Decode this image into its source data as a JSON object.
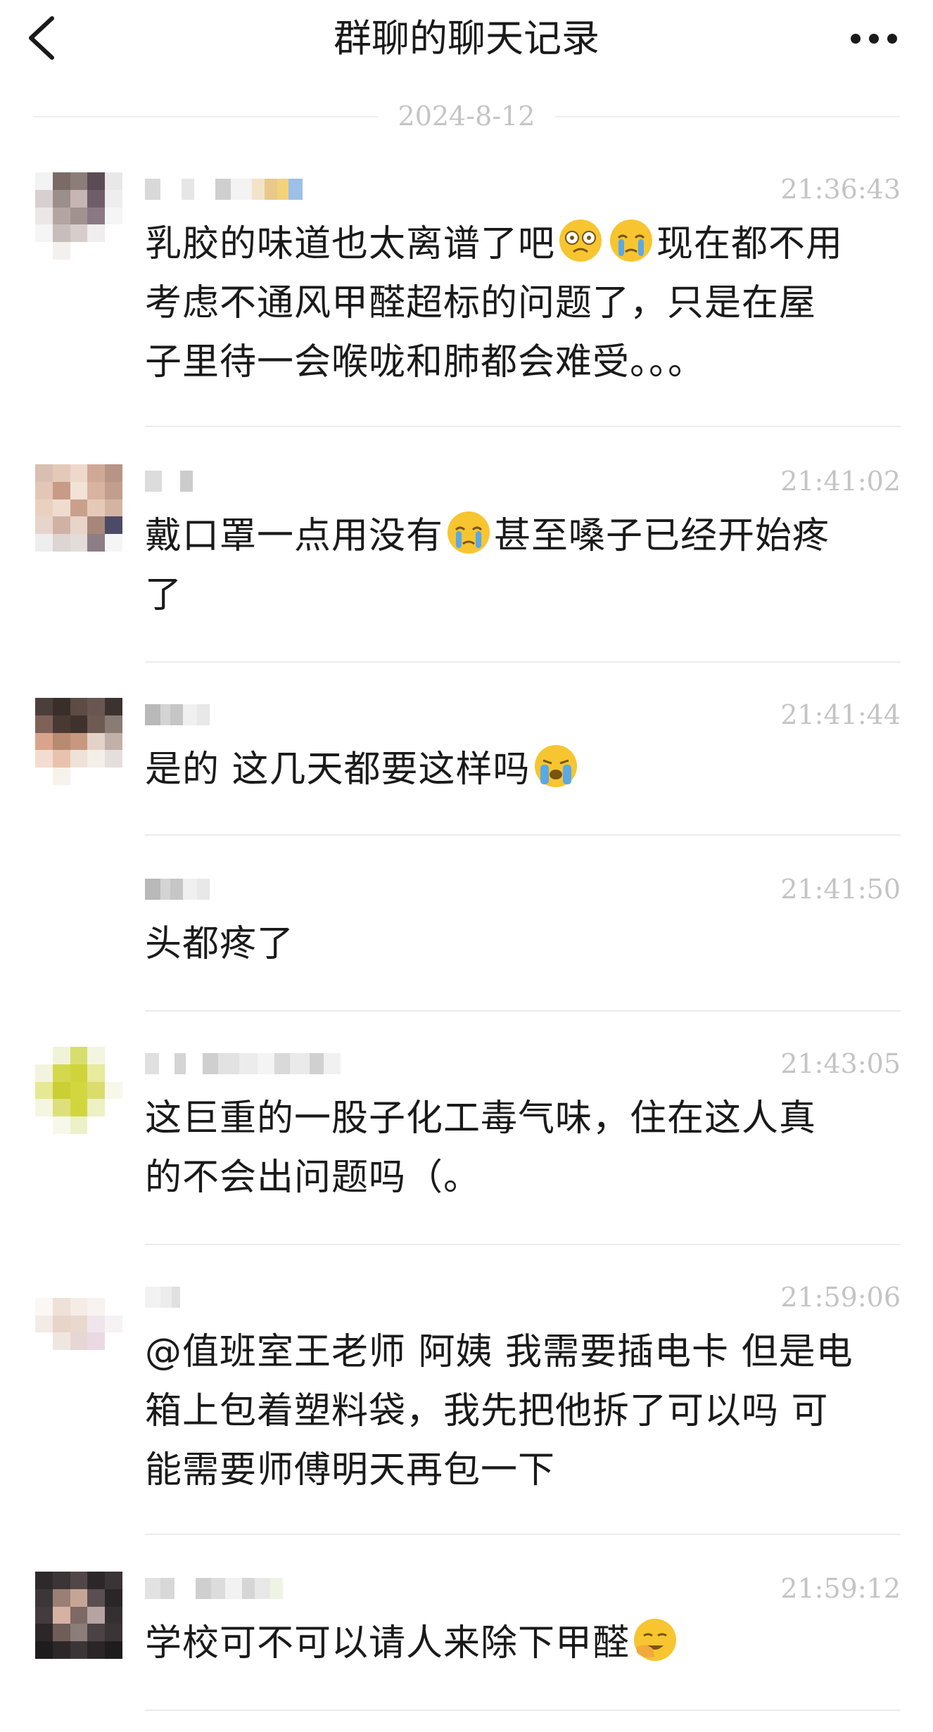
{
  "header": {
    "title": "群聊的聊天记录"
  },
  "date": "2024-8-12",
  "messages": [
    {
      "time": "21:36:43",
      "line1": "乳胶的味道也太离谱了吧",
      "line1b": "现在都不用",
      "line2": "考虑不通风甲醛超标的问题了，只是在屋",
      "line3": "子里待一会喉咙和肺都会难受。。。",
      "emojis": [
        "dizzy-face-icon",
        "crying-face-icon"
      ]
    },
    {
      "time": "21:41:02",
      "line1": "戴口罩一点用没有",
      "line1b": "甚至嗓子已经开始疼",
      "line2": "了",
      "emojis": [
        "crying-face-icon"
      ]
    },
    {
      "time": "21:41:44",
      "line1": "是的 这几天都要这样吗",
      "emojis": [
        "loudly-crying-face-icon"
      ]
    },
    {
      "time": "21:41:50",
      "line1": "头都疼了"
    },
    {
      "time": "21:43:05",
      "line1": "这巨重的一股子化工毒气味，住在这人真",
      "line2": "的不会出问题吗（。"
    },
    {
      "time": "21:59:06",
      "line1": "@值班室王老师 阿姨 我需要插电卡 但是电",
      "line2": "箱上包着塑料袋，我先把他拆了可以吗 可",
      "line3": "能需要师傅明天再包一下"
    },
    {
      "time": "21:59:12",
      "line1": "学校可不可以请人来除下甲醛",
      "emojis": [
        "face-palm-icon"
      ]
    }
  ],
  "colors": {
    "text": "#1a1a1a",
    "muted": "#c4c4c4",
    "divider": "#ececec",
    "emoji_yellow": "#f7c530",
    "tear_blue": "#5aa8e6"
  }
}
